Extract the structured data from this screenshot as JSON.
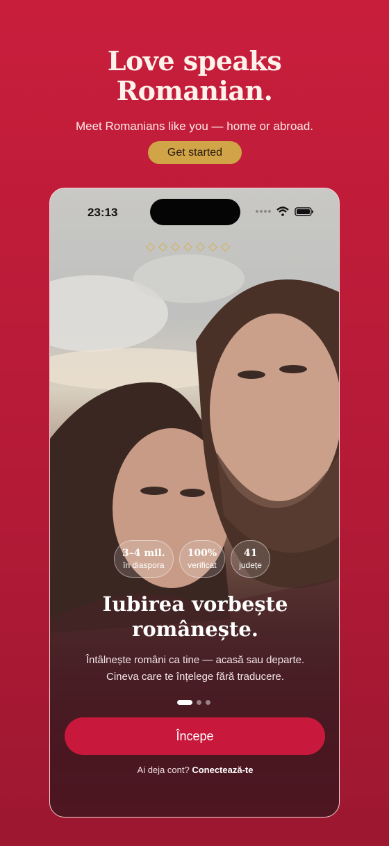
{
  "hero": {
    "title_line1": "Love speaks",
    "title_line2": "Romanian.",
    "subtitle": "Meet Romanians like you — home or abroad.",
    "cta": "Get started"
  },
  "phone": {
    "time": "23:13",
    "stats": [
      {
        "value": "3–4 mil.",
        "label": "în diaspora"
      },
      {
        "value": "100%",
        "label": "verificat"
      },
      {
        "value": "41",
        "label": "județe"
      }
    ],
    "title_line1": "Iubirea vorbește",
    "title_line2": "românește.",
    "sub_line1": "Întâlnește români ca tine — acasă sau departe.",
    "sub_line2": "Cineva care te înțelege fără traducere.",
    "pager": {
      "pages": 3,
      "active": 1
    },
    "start": "Începe",
    "login_prefix": "Ai deja cont?",
    "login_link": "Conectează-te"
  },
  "colors": {
    "brand": "#c8183b",
    "gold": "#d0a447",
    "background": "#c81e3c"
  }
}
